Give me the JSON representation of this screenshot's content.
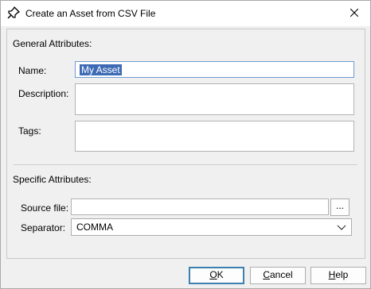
{
  "dialog": {
    "title": "Create an Asset from CSV File"
  },
  "general": {
    "heading": "General Attributes:",
    "name_label": "Name:",
    "name_value": "My Asset",
    "description_label": "Description:",
    "description_value": "",
    "tags_label": "Tags:",
    "tags_value": ""
  },
  "specific": {
    "heading": "Specific Attributes:",
    "source_label": "Source file:",
    "source_value": "",
    "browse_label": "...",
    "separator_label": "Separator:",
    "separator_value": "COMMA"
  },
  "buttons": {
    "ok_mnemonic": "O",
    "ok_rest": "K",
    "cancel_mnemonic": "C",
    "cancel_rest": "ancel",
    "help_mnemonic": "H",
    "help_rest": "elp"
  },
  "icons": {
    "app": "pin-icon",
    "close": "close-icon",
    "dropdown": "chevron-down-icon"
  }
}
